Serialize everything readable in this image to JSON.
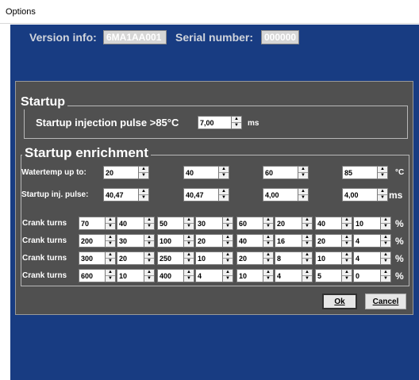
{
  "window": {
    "title": "Options"
  },
  "version": {
    "label": "Version info:",
    "value": "6MA1AA001",
    "serial_label": "Serial number:",
    "serial_value": "000000"
  },
  "startup": {
    "title": "Startup",
    "pulse_label": "Startup injection pulse >85°C",
    "pulse_value": "7,00",
    "pulse_unit": "ms"
  },
  "enrichment": {
    "title": "Startup enrichment",
    "water_label": "Watertemp up to:",
    "water_values": [
      "20",
      "40",
      "60",
      "85"
    ],
    "water_unit": "°C",
    "pulse_label": "Startup inj. pulse:",
    "pulse_values": [
      "40,47",
      "40,47",
      "4,00",
      "4,00"
    ],
    "pulse_unit": "ms",
    "crank_label": "Crank turns",
    "crank_unit": "%",
    "crank_rows": [
      [
        [
          "70",
          "40"
        ],
        [
          "50",
          "30"
        ],
        [
          "60",
          "20"
        ],
        [
          "40",
          "10"
        ]
      ],
      [
        [
          "200",
          "30"
        ],
        [
          "100",
          "20"
        ],
        [
          "40",
          "16"
        ],
        [
          "20",
          "4"
        ]
      ],
      [
        [
          "300",
          "20"
        ],
        [
          "250",
          "10"
        ],
        [
          "20",
          "8"
        ],
        [
          "10",
          "4"
        ]
      ],
      [
        [
          "600",
          "10"
        ],
        [
          "400",
          "4"
        ],
        [
          "10",
          "4"
        ],
        [
          "5",
          "0"
        ]
      ]
    ]
  },
  "buttons": {
    "ok": "Ok",
    "cancel": "Cancel"
  }
}
